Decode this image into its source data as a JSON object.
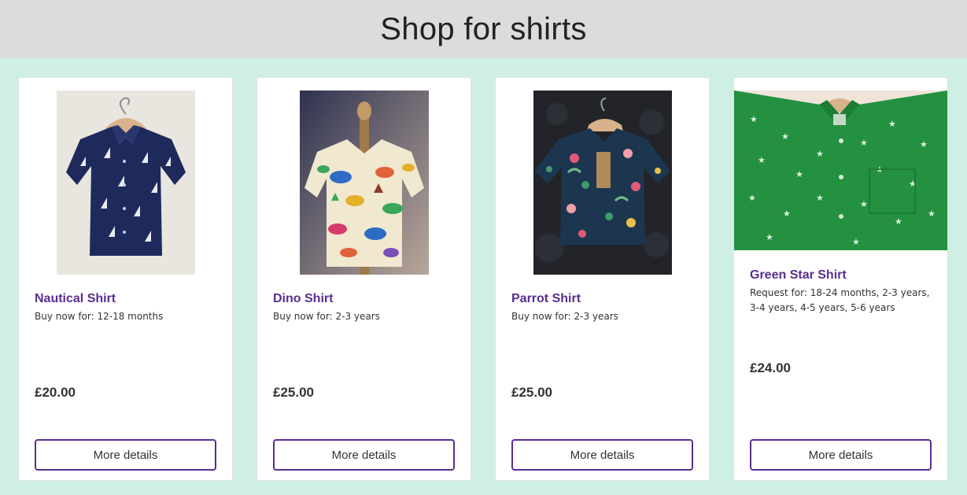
{
  "page": {
    "title": "Shop for shirts"
  },
  "colors": {
    "accent": "#5a2d91",
    "background": "#cfefe5",
    "header": "#dcdcdc"
  },
  "products": [
    {
      "name": "Nautical Shirt",
      "availability": "Buy now for: 12-18 months",
      "price": "£20.00",
      "button_label": "More details"
    },
    {
      "name": "Dino Shirt",
      "availability": "Buy now for: 2-3 years",
      "price": "£25.00",
      "button_label": "More details"
    },
    {
      "name": "Parrot Shirt",
      "availability": "Buy now for: 2-3 years",
      "price": "£25.00",
      "button_label": "More details"
    },
    {
      "name": "Green Star Shirt",
      "availability": "Request for: 18-24 months, 2-3 years, 3-4 years, 4-5 years, 5-6 years",
      "price": "£24.00",
      "button_label": "More details"
    }
  ]
}
